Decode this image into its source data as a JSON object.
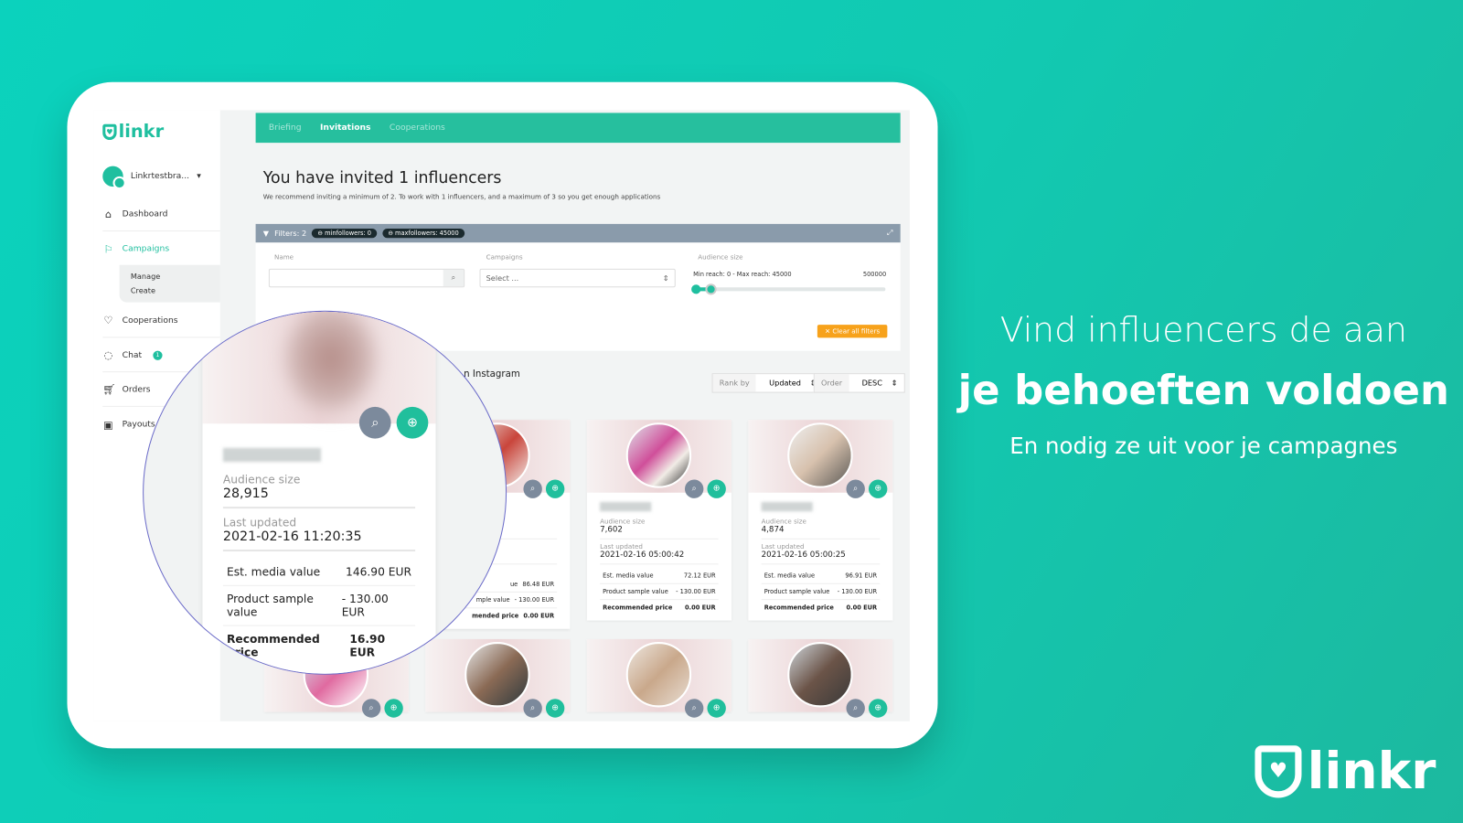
{
  "brand": {
    "name": "linkr",
    "accent": "#1fbf9f"
  },
  "sidebar": {
    "user": "Linkrtestbra...",
    "items": [
      {
        "label": "Dashboard",
        "icon": "home-icon"
      },
      {
        "label": "Campaigns",
        "icon": "flag-icon"
      },
      {
        "label": "Cooperations",
        "icon": "heart-icon"
      },
      {
        "label": "Chat",
        "icon": "chat-icon",
        "badge": "1"
      },
      {
        "label": "Orders",
        "icon": "cart-icon"
      },
      {
        "label": "Payouts",
        "icon": "wallet-icon"
      }
    ],
    "sub": [
      "Manage",
      "Create"
    ]
  },
  "tabs": [
    "Briefing",
    "Invitations",
    "Cooperations"
  ],
  "main": {
    "title": "You have invited 1 influencers",
    "subtitle": "We recommend inviting a minimum of 2. To work with 1 influencers, and a maximum of 3 so you get enough applications"
  },
  "filters": {
    "label": "Filters: 2",
    "chips": [
      "minfollowers: 0",
      "maxfollowers: 45000"
    ],
    "name_label": "Name",
    "campaigns_label": "Campaigns",
    "campaigns_value": "Select ...",
    "audience_label": "Audience size",
    "reach_text": "Min reach: 0 - Max reach: 45000",
    "reach_max": "500000",
    "slider": {
      "min": 0,
      "max": 45000,
      "range_max": 500000
    },
    "clear": "Clear all filters"
  },
  "section": "n Instagram",
  "sort": {
    "rank_label": "Rank by",
    "rank_value": "Updated",
    "order_label": "Order",
    "order_value": "DESC"
  },
  "labels": {
    "audience": "Audience size",
    "updated": "Last updated",
    "media": "Est. media value",
    "sample": "Product sample value",
    "price": "Recommended price"
  },
  "magnified": {
    "audience": "28,915",
    "updated": "2021-02-16 11:20:35",
    "media": "146.90 EUR",
    "sample": "- 130.00 EUR",
    "price": "16.90 EUR"
  },
  "cards": [
    {
      "audience": "14,",
      "updated": "20",
      "partial": "30:57",
      "media": "86.48 EUR",
      "sample": "- 130.00 EUR",
      "price": "0.00 EUR",
      "media_l": "ue",
      "sample_l": "mple value",
      "price_l": "mended price"
    },
    {
      "audience": "7,602",
      "updated": "2021-02-16 05:00:42",
      "media": "72.12 EUR",
      "sample": "- 130.00 EUR",
      "price": "0.00 EUR"
    },
    {
      "audience": "4,874",
      "updated": "2021-02-16 05:00:25",
      "media": "96.91 EUR",
      "sample": "- 130.00 EUR",
      "price": "0.00 EUR"
    }
  ],
  "promo": {
    "line1": "Vind influencers de aan",
    "line2": "je behoeften voldoen",
    "line3": "En nodig ze uit voor je campagnes"
  }
}
